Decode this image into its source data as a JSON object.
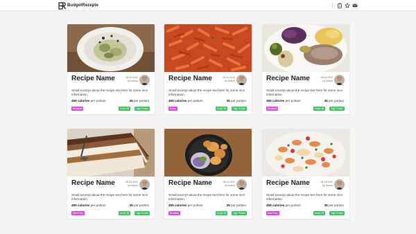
{
  "navbar": {
    "brand": "BudgetRezepte",
    "icons": [
      "clipboard-icon",
      "star-icon",
      "mail-icon"
    ]
  },
  "colors": {
    "category_tag": "#e045e6",
    "badge": "#36c95a",
    "background": "#f5f5f6"
  },
  "cards": [
    {
      "title": "Recipe Name",
      "date": "06.04.2022",
      "author": "by Author",
      "excerpt": "Small excerpt about the recipe text here for some nice information.",
      "calories_value": "459",
      "calories_label": "calories",
      "per_portion": "per portion",
      "price": "3$",
      "price_suffix": "per portion",
      "category": "Breakfast",
      "badges": [
        "Under 5$",
        "High Protein"
      ]
    },
    {
      "title": "Recipe Name",
      "date": "06.04.2022",
      "author": "by Author",
      "excerpt": "Small excerpt about the recipe text here for some nice information.",
      "calories_value": "459",
      "calories_label": "calories",
      "per_portion": "per portion",
      "price": "3$",
      "price_suffix": "per portion",
      "category": "Dinner",
      "badges": [
        "Under 5$",
        "High Protein"
      ]
    },
    {
      "title": "Recipe Name",
      "date": "06.04.2022",
      "author": "by Author",
      "excerpt": "Small excerpt about the recipe text here for some nice information.",
      "calories_value": "459",
      "calories_label": "calories",
      "per_portion": "per portion",
      "price": "3$",
      "price_suffix": "per portion",
      "category": "Breakfast",
      "badges": [
        "Under 5$",
        "High Protein"
      ]
    },
    {
      "title": "Recipe Name",
      "date": "06.04.2022",
      "author": "by Author",
      "excerpt": "Small excerpt about the recipe text here for some nice information.",
      "calories_value": "459",
      "calories_label": "calories",
      "per_portion": "per portion",
      "price": "3$",
      "price_suffix": "per portion",
      "category": "Meal Prep",
      "badges": [
        "Under 5$",
        "High Protein"
      ]
    },
    {
      "title": "Recipe Name",
      "date": "06.04.2022",
      "author": "by Author",
      "excerpt": "Small excerpt about the recipe text here for some nice information.",
      "calories_value": "459",
      "calories_label": "calories",
      "per_portion": "per portion",
      "price": "3$",
      "price_suffix": "per portion",
      "category": "Breakfast",
      "badges": [
        "Under 5$",
        "High Protein"
      ]
    },
    {
      "title": "Recipe Name",
      "date": "06.04.2022",
      "author": "by Author",
      "excerpt": "Small excerpt about the recipe text here for some nice information.",
      "calories_value": "459",
      "calories_label": "calories",
      "per_portion": "per portion",
      "price": "3$",
      "price_suffix": "per portion",
      "category": "Meal Prep",
      "badges": [
        "Under 5$",
        "High Protein"
      ]
    }
  ]
}
